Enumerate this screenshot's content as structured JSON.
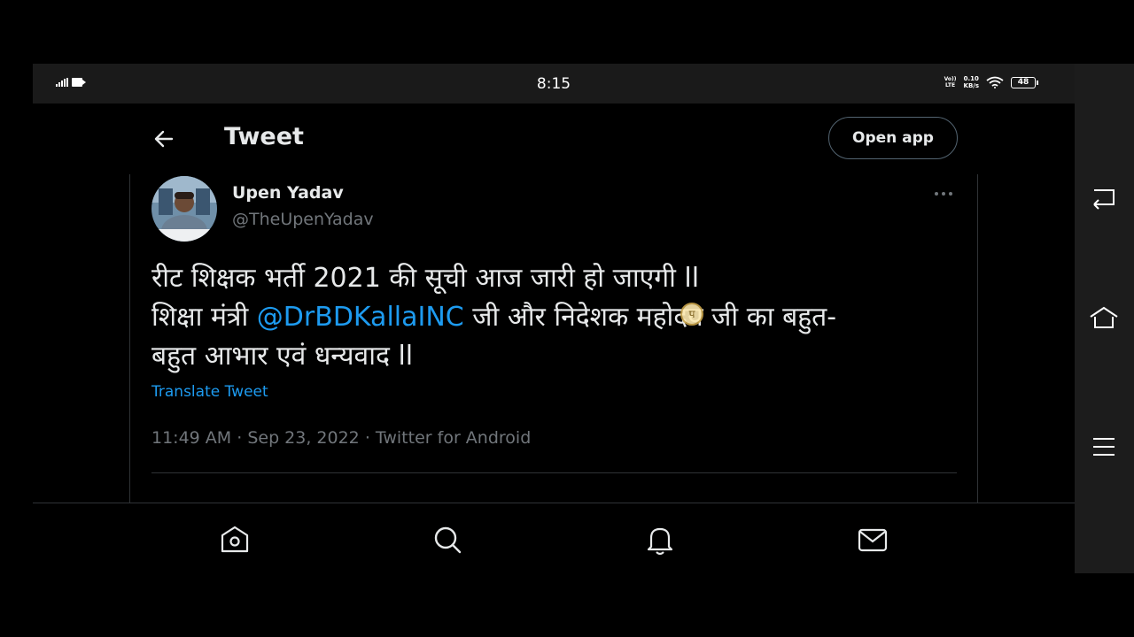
{
  "status_bar": {
    "time": "8:15",
    "volte_top": "Vo))",
    "volte_bottom": "LTE",
    "speed_value": "0.10",
    "speed_unit": "KB/s",
    "battery": "48"
  },
  "header": {
    "title": "Tweet",
    "open_app_label": "Open app"
  },
  "tweet": {
    "author_name": "Upen Yadav",
    "author_handle": "@TheUpenYadav",
    "line1": "रीट शिक्षक भर्ती 2021 की सूची आज जारी हो जाएगी ll",
    "line2_pre": "शिक्षा मंत्री ",
    "mention": "@DrBDKallaINC",
    "line2_post": " जी और निदेशक महोदय जी का बहुत-",
    "line3": "बहुत आभार एवं धन्यवाद ll",
    "translate_label": "Translate Tweet",
    "time": "11:49 AM",
    "date": "Sep 23, 2022",
    "source": "Twitter for Android",
    "separator": " · "
  },
  "cursor_glyph": "प",
  "colors": {
    "background": "#000000",
    "text_primary": "#e7e9ea",
    "text_secondary": "#71767b",
    "link": "#1d9bf0",
    "border": "#2f3336"
  },
  "icons": {
    "back": "arrow-left-icon",
    "more": "more-dots-icon",
    "tabs": [
      "home-icon",
      "search-icon",
      "notifications-icon",
      "messages-icon"
    ],
    "system_nav": [
      "back-nav-icon",
      "home-nav-icon",
      "menu-nav-icon"
    ]
  }
}
